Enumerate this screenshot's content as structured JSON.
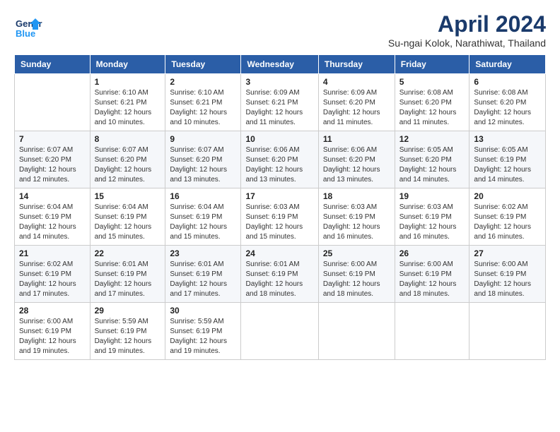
{
  "header": {
    "logo_general": "General",
    "logo_blue": "Blue",
    "month_title": "April 2024",
    "location": "Su-ngai Kolok, Narathiwat, Thailand"
  },
  "weekdays": [
    "Sunday",
    "Monday",
    "Tuesday",
    "Wednesday",
    "Thursday",
    "Friday",
    "Saturday"
  ],
  "weeks": [
    [
      {
        "day": null,
        "info": null
      },
      {
        "day": "1",
        "sunrise": "6:10 AM",
        "sunset": "6:21 PM",
        "daylight": "12 hours and 10 minutes."
      },
      {
        "day": "2",
        "sunrise": "6:10 AM",
        "sunset": "6:21 PM",
        "daylight": "12 hours and 10 minutes."
      },
      {
        "day": "3",
        "sunrise": "6:09 AM",
        "sunset": "6:21 PM",
        "daylight": "12 hours and 11 minutes."
      },
      {
        "day": "4",
        "sunrise": "6:09 AM",
        "sunset": "6:20 PM",
        "daylight": "12 hours and 11 minutes."
      },
      {
        "day": "5",
        "sunrise": "6:08 AM",
        "sunset": "6:20 PM",
        "daylight": "12 hours and 11 minutes."
      },
      {
        "day": "6",
        "sunrise": "6:08 AM",
        "sunset": "6:20 PM",
        "daylight": "12 hours and 12 minutes."
      }
    ],
    [
      {
        "day": "7",
        "sunrise": "6:07 AM",
        "sunset": "6:20 PM",
        "daylight": "12 hours and 12 minutes."
      },
      {
        "day": "8",
        "sunrise": "6:07 AM",
        "sunset": "6:20 PM",
        "daylight": "12 hours and 12 minutes."
      },
      {
        "day": "9",
        "sunrise": "6:07 AM",
        "sunset": "6:20 PM",
        "daylight": "12 hours and 13 minutes."
      },
      {
        "day": "10",
        "sunrise": "6:06 AM",
        "sunset": "6:20 PM",
        "daylight": "12 hours and 13 minutes."
      },
      {
        "day": "11",
        "sunrise": "6:06 AM",
        "sunset": "6:20 PM",
        "daylight": "12 hours and 13 minutes."
      },
      {
        "day": "12",
        "sunrise": "6:05 AM",
        "sunset": "6:20 PM",
        "daylight": "12 hours and 14 minutes."
      },
      {
        "day": "13",
        "sunrise": "6:05 AM",
        "sunset": "6:19 PM",
        "daylight": "12 hours and 14 minutes."
      }
    ],
    [
      {
        "day": "14",
        "sunrise": "6:04 AM",
        "sunset": "6:19 PM",
        "daylight": "12 hours and 14 minutes."
      },
      {
        "day": "15",
        "sunrise": "6:04 AM",
        "sunset": "6:19 PM",
        "daylight": "12 hours and 15 minutes."
      },
      {
        "day": "16",
        "sunrise": "6:04 AM",
        "sunset": "6:19 PM",
        "daylight": "12 hours and 15 minutes."
      },
      {
        "day": "17",
        "sunrise": "6:03 AM",
        "sunset": "6:19 PM",
        "daylight": "12 hours and 15 minutes."
      },
      {
        "day": "18",
        "sunrise": "6:03 AM",
        "sunset": "6:19 PM",
        "daylight": "12 hours and 16 minutes."
      },
      {
        "day": "19",
        "sunrise": "6:03 AM",
        "sunset": "6:19 PM",
        "daylight": "12 hours and 16 minutes."
      },
      {
        "day": "20",
        "sunrise": "6:02 AM",
        "sunset": "6:19 PM",
        "daylight": "12 hours and 16 minutes."
      }
    ],
    [
      {
        "day": "21",
        "sunrise": "6:02 AM",
        "sunset": "6:19 PM",
        "daylight": "12 hours and 17 minutes."
      },
      {
        "day": "22",
        "sunrise": "6:01 AM",
        "sunset": "6:19 PM",
        "daylight": "12 hours and 17 minutes."
      },
      {
        "day": "23",
        "sunrise": "6:01 AM",
        "sunset": "6:19 PM",
        "daylight": "12 hours and 17 minutes."
      },
      {
        "day": "24",
        "sunrise": "6:01 AM",
        "sunset": "6:19 PM",
        "daylight": "12 hours and 18 minutes."
      },
      {
        "day": "25",
        "sunrise": "6:00 AM",
        "sunset": "6:19 PM",
        "daylight": "12 hours and 18 minutes."
      },
      {
        "day": "26",
        "sunrise": "6:00 AM",
        "sunset": "6:19 PM",
        "daylight": "12 hours and 18 minutes."
      },
      {
        "day": "27",
        "sunrise": "6:00 AM",
        "sunset": "6:19 PM",
        "daylight": "12 hours and 18 minutes."
      }
    ],
    [
      {
        "day": "28",
        "sunrise": "6:00 AM",
        "sunset": "6:19 PM",
        "daylight": "12 hours and 19 minutes."
      },
      {
        "day": "29",
        "sunrise": "5:59 AM",
        "sunset": "6:19 PM",
        "daylight": "12 hours and 19 minutes."
      },
      {
        "day": "30",
        "sunrise": "5:59 AM",
        "sunset": "6:19 PM",
        "daylight": "12 hours and 19 minutes."
      },
      {
        "day": null,
        "info": null
      },
      {
        "day": null,
        "info": null
      },
      {
        "day": null,
        "info": null
      },
      {
        "day": null,
        "info": null
      }
    ]
  ]
}
